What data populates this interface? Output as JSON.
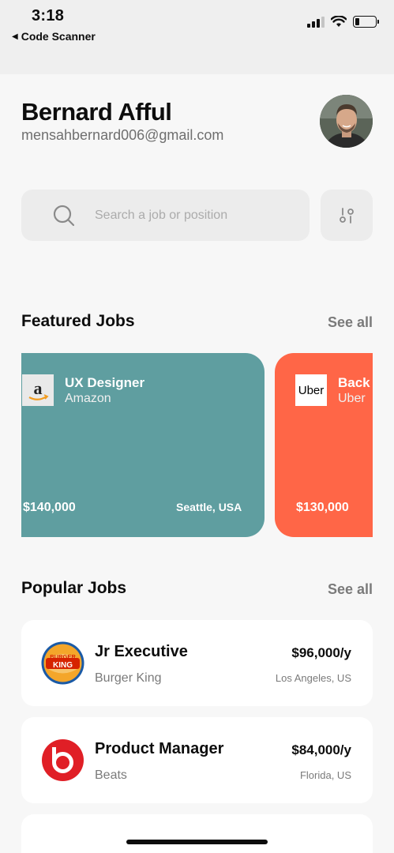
{
  "status_bar": {
    "time": "3:18",
    "back_app": "Code Scanner",
    "back_icon": "back-arrow-icon",
    "battery_level": 0.2
  },
  "profile": {
    "name": "Bernard Afful",
    "email": "mensahbernard006@gmail.com"
  },
  "search": {
    "placeholder": "Search a job or position",
    "value": ""
  },
  "featured": {
    "title": "Featured Jobs",
    "see_all": "See all",
    "jobs": [
      {
        "title": "UX Designer",
        "company": "Amazon",
        "salary": "$140,000",
        "location": "Seattle, USA",
        "color": "#5f9ea0"
      },
      {
        "title": "Back",
        "company": "Uber",
        "salary": "$130,000",
        "location": "",
        "color": "#ff6647",
        "logo_text": "Uber"
      }
    ]
  },
  "popular": {
    "title": "Popular Jobs",
    "see_all": "See all",
    "jobs": [
      {
        "title": "Jr Executive",
        "company": "Burger King",
        "salary": "$96,000/y",
        "location": "Los Angeles, US",
        "logo_text": "BURGER KING"
      },
      {
        "title": "Product Manager",
        "company": "Beats",
        "salary": "$84,000/y",
        "location": "Florida, US"
      }
    ]
  },
  "colors": {
    "background": "#f7f7f7",
    "teal_card": "#5f9ea0",
    "orange_card": "#ff6647",
    "muted_text": "#7a7a7a"
  }
}
